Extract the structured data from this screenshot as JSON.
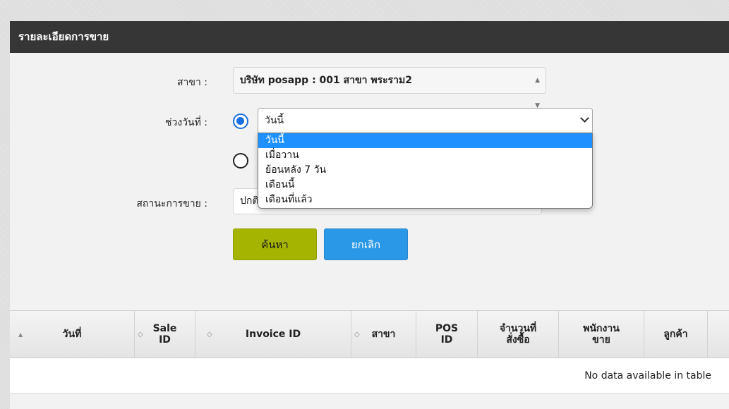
{
  "panel": {
    "title": "รายละเอียดการขาย"
  },
  "form": {
    "branch_label": "สาขา :",
    "branch_value": "บริษัท posapp : 001 สาขา พระราม2",
    "date_label": "ช่วงวันที่ :",
    "date_value": "วันนี้",
    "date_options": [
      "วันนี้",
      "เมื่อวาน",
      "ย้อนหลัง 7 วัน",
      "เดือนนี้",
      "เดือนที่แล้ว"
    ],
    "status_label": "สถานะการขาย :",
    "status_value": "ปกติ"
  },
  "buttons": {
    "search": "ค้นหา",
    "cancel": "ยกเลิก"
  },
  "table": {
    "columns": [
      "วันที่",
      "Sale ID",
      "Invoice ID",
      "สาขา",
      "POS ID",
      "จำนวนที่สั่งซื้อ",
      "พนักงานขาย",
      "ลูกค้า"
    ],
    "empty_text": "No data available in table"
  },
  "colors": {
    "header_bg": "#363636",
    "search_btn": "#a4b400",
    "cancel_btn": "#2b98e7",
    "selected_option": "#1e90ff"
  }
}
